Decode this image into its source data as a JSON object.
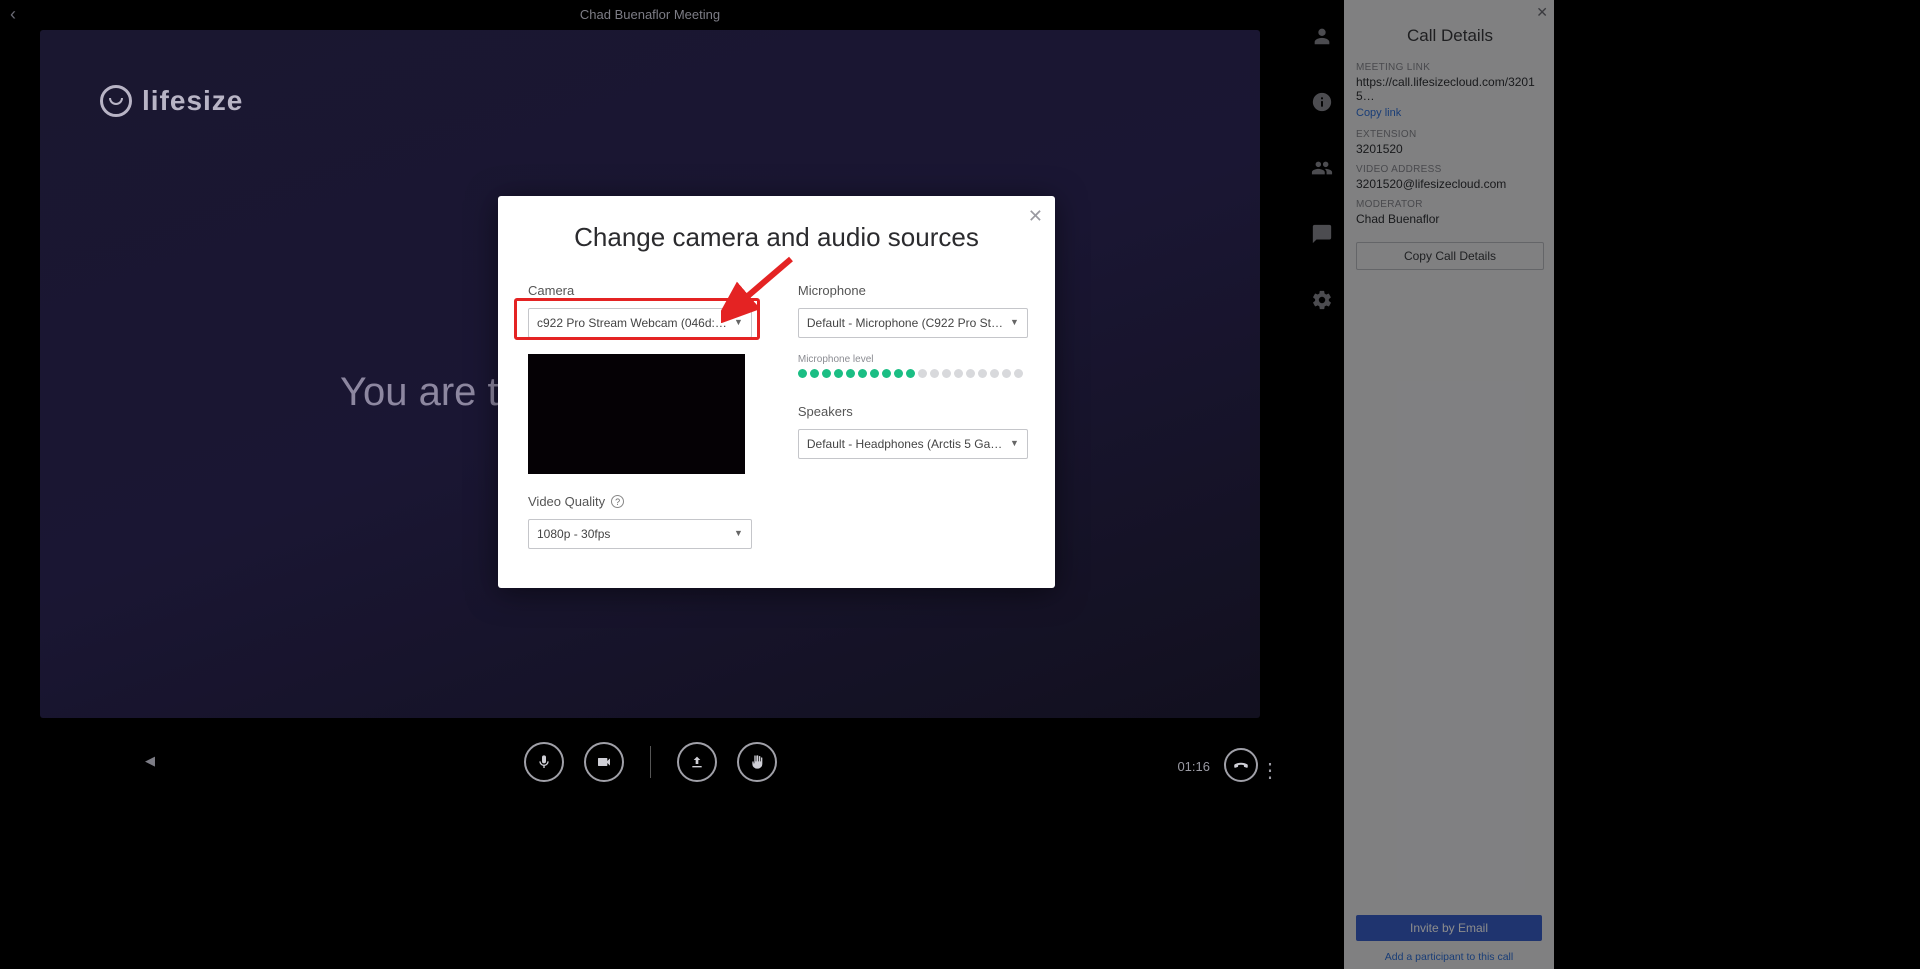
{
  "header": {
    "title": "Chad Buenaflor Meeting"
  },
  "logo": {
    "brand": "lifesize"
  },
  "stage": {
    "only_participant_text": "You are th"
  },
  "controls": {
    "elapsed_time": "01:16"
  },
  "modal": {
    "title": "Change camera and audio sources",
    "camera_label": "Camera",
    "camera_value": "c922 Pro Stream Webcam (046d:…",
    "video_quality_label": "Video Quality",
    "video_quality_value": "1080p - 30fps",
    "microphone_label": "Microphone",
    "microphone_value": "Default - Microphone (C922 Pro St…",
    "mic_level_label": "Microphone level",
    "mic_level_active": 10,
    "mic_level_total": 19,
    "speakers_label": "Speakers",
    "speakers_value": "Default - Headphones (Arctis 5 Ga…"
  },
  "details": {
    "panel_title": "Call Details",
    "meeting_link_label": "Meeting Link",
    "meeting_link_value": "https://call.lifesizecloud.com/32015…",
    "copy_link": "Copy link",
    "extension_label": "Extension",
    "extension_value": "3201520",
    "video_address_label": "Video Address",
    "video_address_value": "3201520@lifesizecloud.com",
    "moderator_label": "Moderator",
    "moderator_value": "Chad Buenaflor",
    "copy_details": "Copy Call Details",
    "invite_email": "Invite by Email",
    "add_participant": "Add a participant to this call"
  }
}
